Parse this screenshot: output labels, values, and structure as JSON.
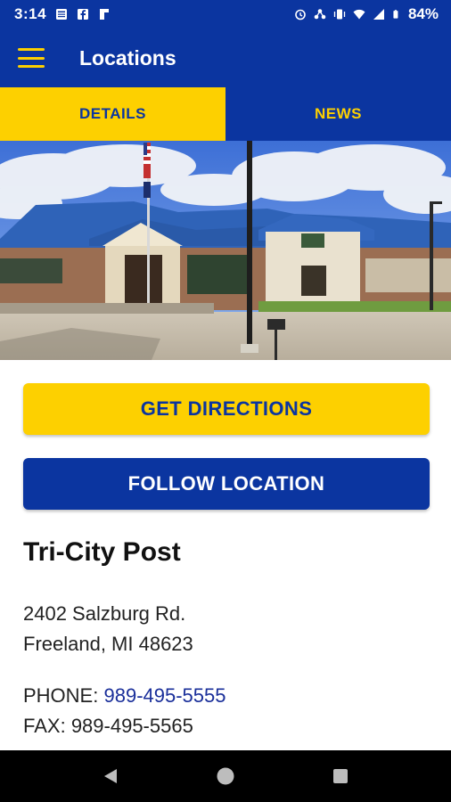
{
  "status_bar": {
    "time": "3:14",
    "battery": "84%",
    "left_icons": [
      "news-icon",
      "facebook-icon",
      "flipboard-icon"
    ],
    "right_icons": [
      "alarm-icon",
      "network-icon",
      "vibrate-icon",
      "wifi-icon",
      "signal-icon",
      "battery-icon"
    ]
  },
  "app_bar": {
    "title": "Locations",
    "menu_icon": "hamburger-menu-icon"
  },
  "tabs": [
    {
      "label": "DETAILS",
      "active": true
    },
    {
      "label": "NEWS",
      "active": false
    }
  ],
  "actions": {
    "directions_label": "GET DIRECTIONS",
    "follow_label": "FOLLOW LOCATION"
  },
  "location": {
    "name": "Tri-City Post",
    "address_line1": "2402 Salzburg Rd.",
    "address_line2": "Freeland, MI 48623",
    "phone_label": "PHONE:",
    "phone": "989-495-5555",
    "fax_label": "FAX:",
    "fax": "989-495-5565"
  },
  "colors": {
    "brand_blue": "#0b35a0",
    "brand_yellow": "#fdd000",
    "link_blue": "#1a2f9a"
  },
  "nav_bar": {
    "icons": [
      "back-icon",
      "home-icon",
      "recents-icon"
    ]
  }
}
